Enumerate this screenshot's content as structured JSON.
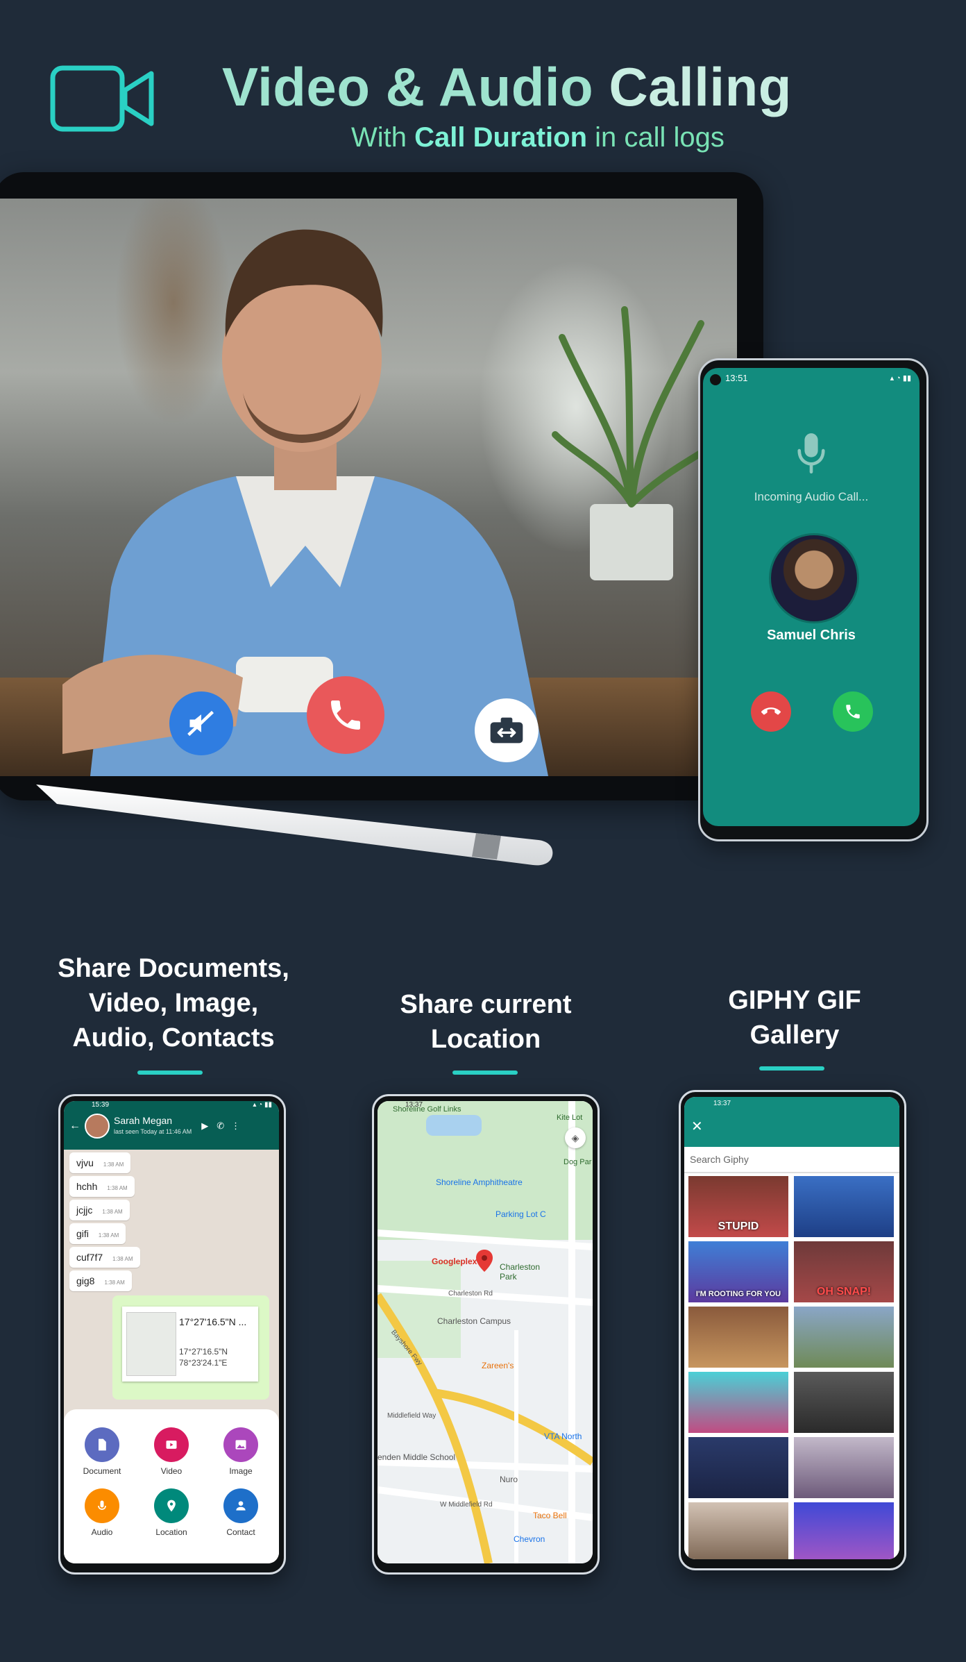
{
  "header": {
    "title_part1": "Video & Audio",
    "title_part2": "Calling",
    "subtitle_pre": "With",
    "subtitle_bold": "Call Duration",
    "subtitle_post": "in call logs",
    "icon": "video-camera-icon"
  },
  "colors": {
    "background": "#1f2b39",
    "accent": "#2ad0c4",
    "whatsapp_green": "#128c7e",
    "end_call": "#e9585a",
    "mute": "#2f7de1"
  },
  "video_call": {
    "buttons": [
      "mute-icon",
      "end-call-icon",
      "switch-camera-icon"
    ]
  },
  "incoming_call": {
    "status_time": "13:51",
    "status_text": "Incoming Audio Call...",
    "caller_name": "Samuel Chris"
  },
  "features": [
    {
      "lines": [
        "Share Documents,",
        "Video, Image,",
        "Audio, Contacts"
      ]
    },
    {
      "lines": [
        "Share current",
        "Location"
      ]
    },
    {
      "lines": [
        "GIPHY GIF",
        "Gallery"
      ]
    }
  ],
  "chat": {
    "status_time": "15:39",
    "contact_name": "Sarah Megan",
    "last_seen": "last seen Today at 11:46 AM",
    "messages": [
      {
        "text": "vjvu",
        "time": "1:38 AM"
      },
      {
        "text": "hchh",
        "time": "1:38 AM"
      },
      {
        "text": "jcjjc",
        "time": "1:38 AM"
      },
      {
        "text": "gifi",
        "time": "1:38 AM"
      },
      {
        "text": "cuf7f7",
        "time": "1:38 AM"
      },
      {
        "text": "gig8",
        "time": "1:38 AM"
      }
    ],
    "location_msg": {
      "coord_big": "17°27'16.5\"N ...",
      "line1": "17°27'16.5\"N",
      "line2": "78°23'24.1\"E"
    },
    "attachments": [
      {
        "label": "Document",
        "color": "#5c6bc0"
      },
      {
        "label": "Video",
        "color": "#d81b60"
      },
      {
        "label": "Image",
        "color": "#ab47bc"
      },
      {
        "label": "Audio",
        "color": "#fb8c00"
      },
      {
        "label": "Location",
        "color": "#00897b"
      },
      {
        "label": "Contact",
        "color": "#1e6fc9"
      }
    ]
  },
  "map": {
    "status_time": "13:37",
    "labels": {
      "golf": "Shoreline Golf Links",
      "kite": "Kite Lot",
      "dog": "Dog Par",
      "amphitheatre": "Shoreline Amphitheatre",
      "parking": "Parking Lot C",
      "googleplex": "Googleplex",
      "park": "Charleston Park",
      "charleston_rd": "Charleston Rd",
      "campus": "Charleston Campus",
      "bayshore": "Bayshore Fwy",
      "zareens": "Zareen's",
      "middlefield": "Middlefield Way",
      "vta": "VTA North",
      "school": "enden Middle School",
      "nuro": "Nuro",
      "w_middlefield": "W Middlefield Rd",
      "taco": "Taco Bell",
      "chevron": "Chevron"
    }
  },
  "giphy": {
    "status_time": "13:37",
    "search_placeholder": "Search Giphy",
    "gif_captions": [
      "STUPID",
      "",
      "I'M ROOTING FOR YOU",
      "OH SNAP!",
      "",
      "",
      "",
      "",
      "",
      "",
      "",
      ""
    ]
  }
}
